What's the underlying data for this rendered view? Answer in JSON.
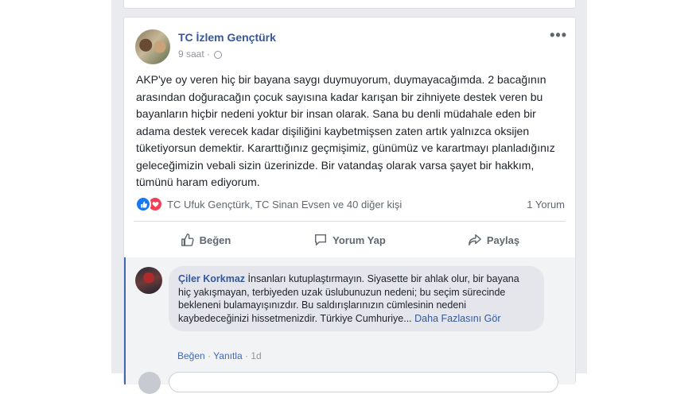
{
  "post": {
    "author": "TC İzlem Gençtürk",
    "time": "9 saat",
    "time_separator": "·",
    "more_menu": "•••",
    "text": "AKP'ye oy veren hiç bir bayana saygı duymuyorum, duymayacağımda. 2 bacağının arasından doğuracağın çocuk sayısına kadar karışan bir zihniyete destek veren bu bayanların hiçbir nedeni yoktur bir insan olarak. Sana bu denli müdahale eden bir adama destek verecek kadar dişiliğini kaybetmişsen zaten artık yalnızca oksijen tüketiyorsun demektir. Kararttığınız geçmişimiz, günümüz ve karartmayı planladığınız geleceğimizin vebali sizin üzerinizde. Bir vatandaş olarak varsa şayet bir hakkım, tümünü haram ediyorum.",
    "reactions_text": "TC Ufuk Gençtürk, TC Sinan Evsen ve 40 diğer kişi",
    "comment_count": "1 Yorum"
  },
  "actions": {
    "like": "Beğen",
    "comment": "Yorum Yap",
    "share": "Paylaş"
  },
  "comment": {
    "author": "Çiler Korkmaz",
    "text": "İnsanları kutuplaştırmayın. Siyasette bir ahlak olur, bir bayana hiç yakışmayan, terbiyeden uzak üslubunuzun nedeni; bu seçim sürecinde bekleneni bulamayışınızdır. Bu saldırışlarınızın cümlesinin nedeni kaybedeceğinizi hissetmenizdir. Türkiye Cumhuriye...",
    "see_more": "Daha Fazlasını Gör",
    "like": "Beğen",
    "reply": "Yanıtla",
    "separator": "·",
    "time": "1d"
  },
  "colors": {
    "link": "#365899",
    "like_reaction": "#1877f2",
    "love_reaction": "#f33e58",
    "feed_background": "#e9ebee"
  }
}
